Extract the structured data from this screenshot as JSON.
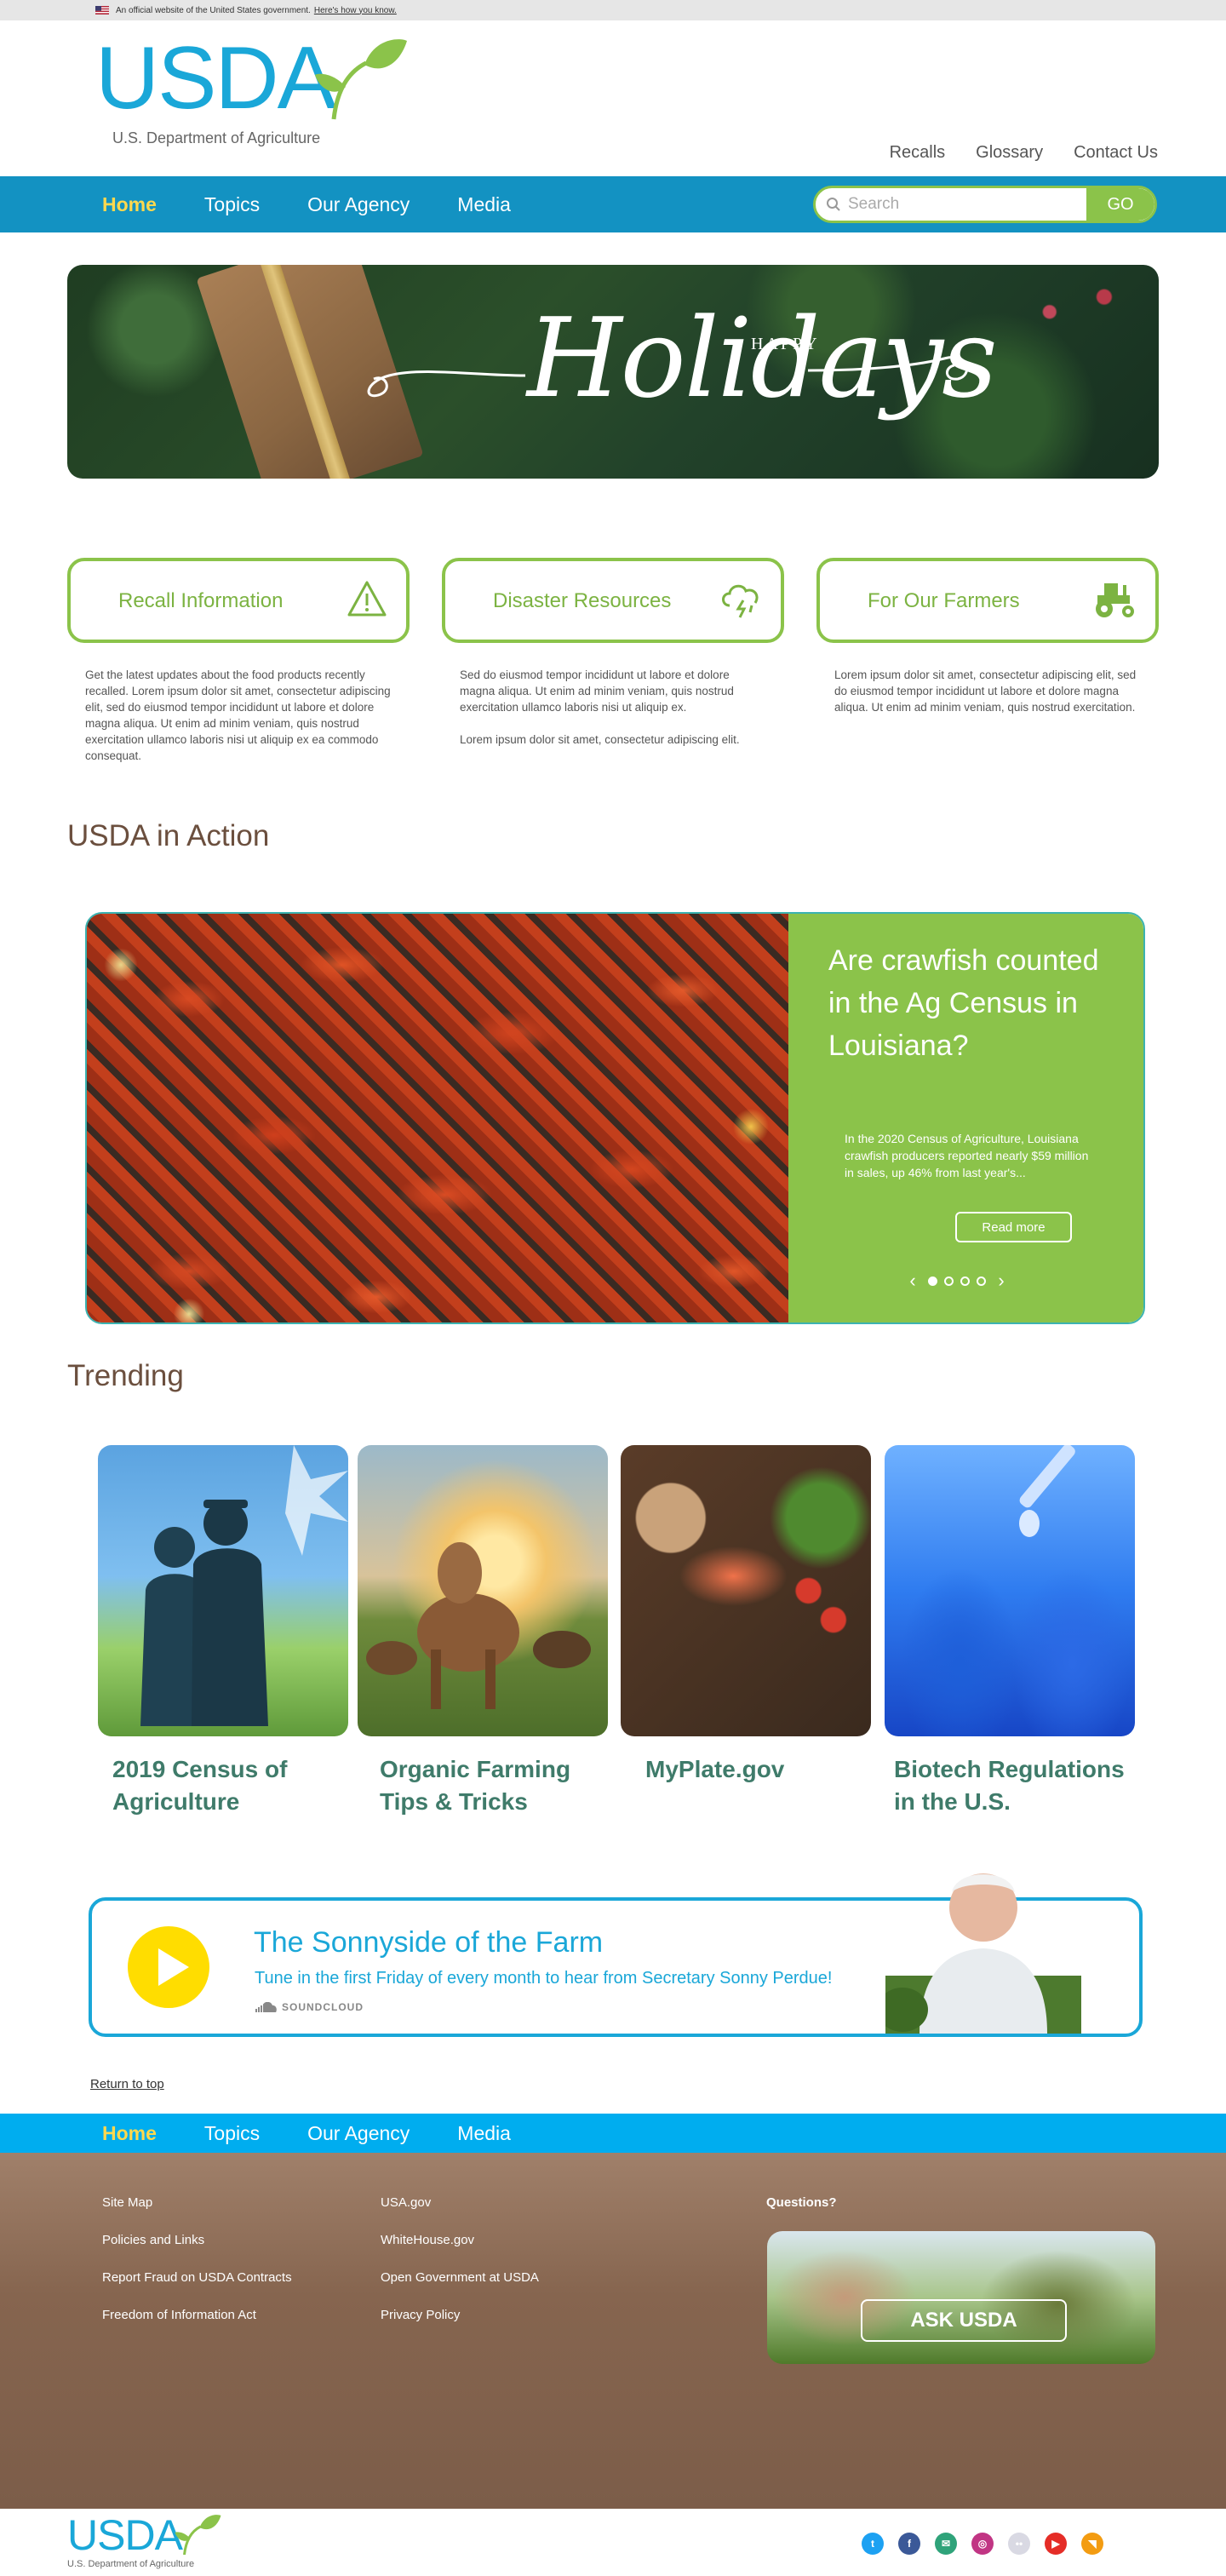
{
  "gov_banner": {
    "text": "An official website of the United States government.",
    "link": "Here's how you know."
  },
  "header": {
    "logo_text": "USDA",
    "logo_subtitle": "U.S. Department of Agriculture",
    "utility_links": [
      "Recalls",
      "Glossary",
      "Contact Us"
    ]
  },
  "nav": {
    "items": [
      "Home",
      "Topics",
      "Our Agency",
      "Media"
    ],
    "active": "Home",
    "search_placeholder": "Search",
    "search_button": "GO"
  },
  "hero": {
    "small": "HAPPY",
    "big": "Holidays"
  },
  "quick_cards": [
    {
      "label": "Recall Information",
      "icon": "warning-icon",
      "text": [
        "Get the latest updates about the food products recently recalled. Lorem ipsum dolor sit amet, consectetur adipiscing elit, sed do eiusmod tempor incididunt ut labore et dolore magna aliqua. Ut enim ad minim veniam, quis nostrud exercitation ullamco laboris nisi ut aliquip ex ea commodo consequat."
      ]
    },
    {
      "label": "Disaster Resources",
      "icon": "storm-cloud-icon",
      "text": [
        "Sed do eiusmod tempor incididunt ut labore et dolore magna aliqua. Ut enim ad minim veniam, quis nostrud exercitation ullamco laboris nisi ut aliquip ex.",
        "Lorem ipsum dolor sit amet, consectetur adipiscing elit."
      ]
    },
    {
      "label": "For Our Farmers",
      "icon": "tractor-icon",
      "text": [
        "Lorem ipsum dolor sit amet, consectetur adipiscing elit, sed do eiusmod tempor incididunt ut labore et dolore magna aliqua. Ut enim ad minim veniam, quis nostrud exercitation."
      ]
    }
  ],
  "action": {
    "section_title": "USDA in Action",
    "title": "Are crawfish counted in the Ag Census in Louisiana?",
    "text": "In the 2020 Census of Agriculture, Louisiana crawfish producers reported nearly $59 million in sales, up 46% from last year's...",
    "button": "Read more",
    "prev": "‹",
    "next": "›",
    "slides": 4,
    "active_slide": 1
  },
  "trending": {
    "section_title": "Trending",
    "items": [
      {
        "label": "2019 Census of Agriculture"
      },
      {
        "label": "Organic Farming Tips & Tricks"
      },
      {
        "label": "MyPlate.gov"
      },
      {
        "label": "Biotech Regulations in the U.S."
      }
    ]
  },
  "podcast": {
    "title": "The Sonnyside of the Farm",
    "subtitle": "Tune in the first Friday of every month to hear from Secretary Sonny Perdue!",
    "provider": "SOUNDCLOUD"
  },
  "return_top": "Return to top",
  "footer": {
    "nav": [
      "Home",
      "Topics",
      "Our Agency",
      "Media"
    ],
    "col1": [
      "Site Map",
      "Policies and Links",
      "Report Fraud on USDA Contracts",
      "Freedom of Information Act"
    ],
    "col2": [
      "USA.gov",
      "WhiteHouse.gov",
      "Open Government at USDA",
      "Privacy Policy"
    ],
    "questions": "Questions?",
    "ask_button": "ASK USDA",
    "logo_text": "USDA",
    "logo_subtitle": "U.S. Department of Agriculture",
    "social": [
      {
        "name": "twitter-icon",
        "glyph": "t",
        "color": "#1da1f2"
      },
      {
        "name": "facebook-icon",
        "glyph": "f",
        "color": "#3b5998"
      },
      {
        "name": "email-icon",
        "glyph": "✉",
        "color": "#2fa37a"
      },
      {
        "name": "instagram-icon",
        "glyph": "◎",
        "color": "#c13584"
      },
      {
        "name": "flickr-icon",
        "glyph": "••",
        "color": "#d9d9e3"
      },
      {
        "name": "youtube-icon",
        "glyph": "▶",
        "color": "#e52d27"
      },
      {
        "name": "rss-icon",
        "glyph": "◥",
        "color": "#f39c12"
      }
    ]
  }
}
